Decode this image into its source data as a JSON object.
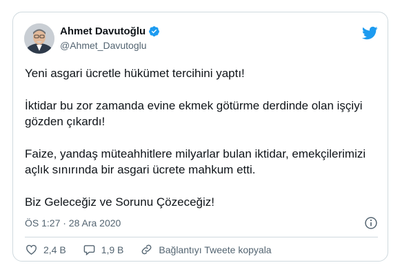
{
  "author": {
    "name": "Ahmet Davutoğlu",
    "handle": "@Ahmet_Davutoglu"
  },
  "tweet": {
    "paragraphs": [
      "Yeni asgari ücretle hükümet tercihini yaptı!",
      "İktidar bu zor zamanda evine ekmek götürme derdinde olan işçiyi gözden çıkardı!",
      "Faize, yandaş müteahhitlere milyarlar bulan iktidar, emekçilerimizi açlık sınırında bir asgari ücrete mahkum etti.",
      "Biz Geleceğiz ve Sorunu Çözeceğiz!"
    ],
    "timestamp": "ÖS 1:27 · 28 Ara 2020"
  },
  "actions": {
    "likes": "2,4 B",
    "replies": "1,9 B",
    "copy_link": "Bağlantıyı Tweete kopyala"
  },
  "colors": {
    "twitter_blue": "#1d9bf0",
    "secondary_text": "#536471",
    "border": "#cfd9de"
  }
}
